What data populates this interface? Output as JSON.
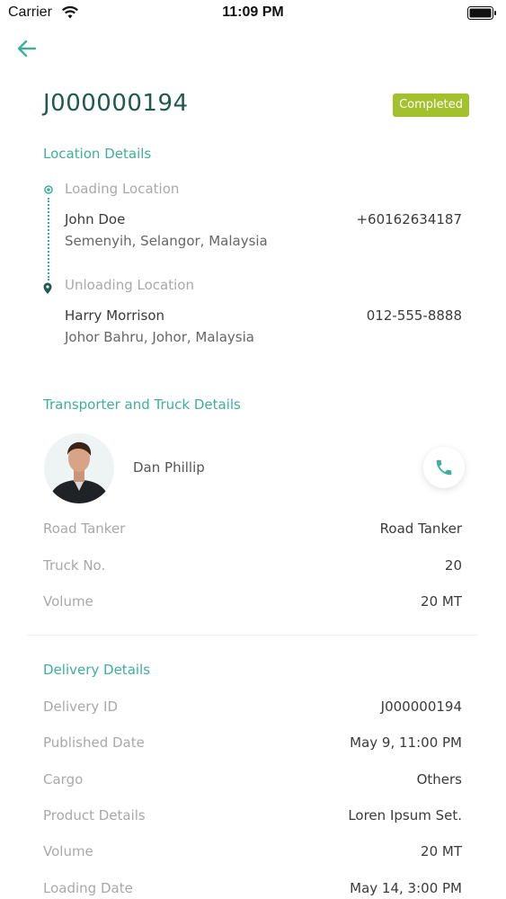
{
  "status_bar": {
    "carrier": "Carrier",
    "time": "11:09 PM"
  },
  "header": {
    "job_id": "J000000194",
    "status_badge": "Completed"
  },
  "location": {
    "title": "Location Details",
    "loading": {
      "label": "Loading Location",
      "name": "John Doe",
      "address": "Semenyih, Selangor, Malaysia",
      "phone": "+60162634187"
    },
    "unloading": {
      "label": "Unloading Location",
      "name": "Harry Morrison",
      "address": "Johor Bahru, Johor, Malaysia",
      "phone": "012-555-8888"
    }
  },
  "transporter": {
    "title": "Transporter and Truck Details",
    "driver_name": "Dan Phillip",
    "rows": [
      {
        "label": "Road Tanker",
        "value": "Road Tanker"
      },
      {
        "label": "Truck No.",
        "value": "20"
      },
      {
        "label": "Volume",
        "value": "20 MT"
      }
    ]
  },
  "delivery": {
    "title": "Delivery Details",
    "rows": [
      {
        "label": "Delivery ID",
        "value": "J000000194"
      },
      {
        "label": "Published Date",
        "value": "May 9, 11:00 PM"
      },
      {
        "label": "Cargo",
        "value": "Others"
      },
      {
        "label": "Product Details",
        "value": "Loren Ipsum Set."
      },
      {
        "label": "Volume",
        "value": "20 MT"
      },
      {
        "label": "Loading Date",
        "value": "May 14, 3:00 PM"
      }
    ]
  },
  "colors": {
    "accent": "#3fae9b",
    "badge": "#a2c12c",
    "title": "#1f5a4e"
  },
  "icons": {
    "back": "arrow-left-icon",
    "phone": "phone-icon",
    "wifi": "wifi-icon",
    "battery": "battery-icon"
  }
}
